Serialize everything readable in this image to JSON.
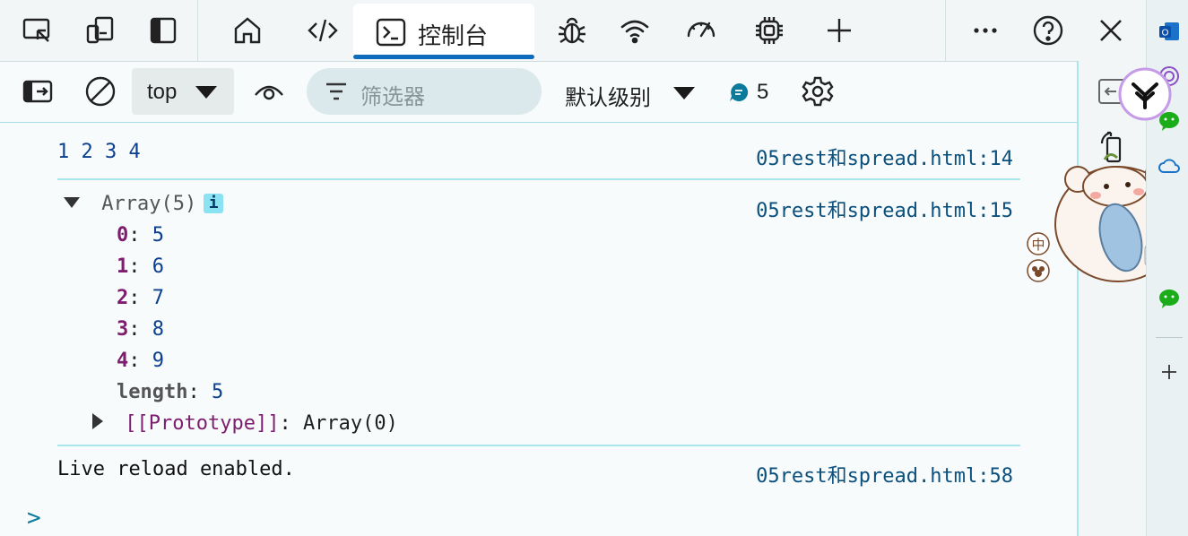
{
  "tabs": {
    "console_label": "控制台"
  },
  "toolbar": {
    "context_value": "top",
    "filter_placeholder": "筛选器",
    "levels_label": "默认级别",
    "message_count": "5"
  },
  "console": {
    "rows": [
      {
        "text": "1 2 3 4",
        "source": "05rest和spread.html:14"
      },
      {
        "text": "Array(5)",
        "source": "05rest和spread.html:15",
        "badge": "i"
      },
      {
        "text": "Live reload enabled.",
        "source": "05rest和spread.html:58"
      }
    ],
    "array_entries": [
      {
        "key": "0",
        "value": "5"
      },
      {
        "key": "1",
        "value": "6"
      },
      {
        "key": "2",
        "value": "7"
      },
      {
        "key": "3",
        "value": "8"
      },
      {
        "key": "4",
        "value": "9"
      }
    ],
    "length_key": "length",
    "length_value": "5",
    "prototype_key": "[[Prototype]]",
    "prototype_value": "Array(0)",
    "prompt": ">"
  },
  "mascot": {
    "ime_label": "中"
  },
  "colors": {
    "accent": "#0f6cbd",
    "row_separator": "#a9e6ec",
    "number": "#0b3f8f",
    "key": "#7d1d6e",
    "source_link": "#0b4f7c"
  }
}
